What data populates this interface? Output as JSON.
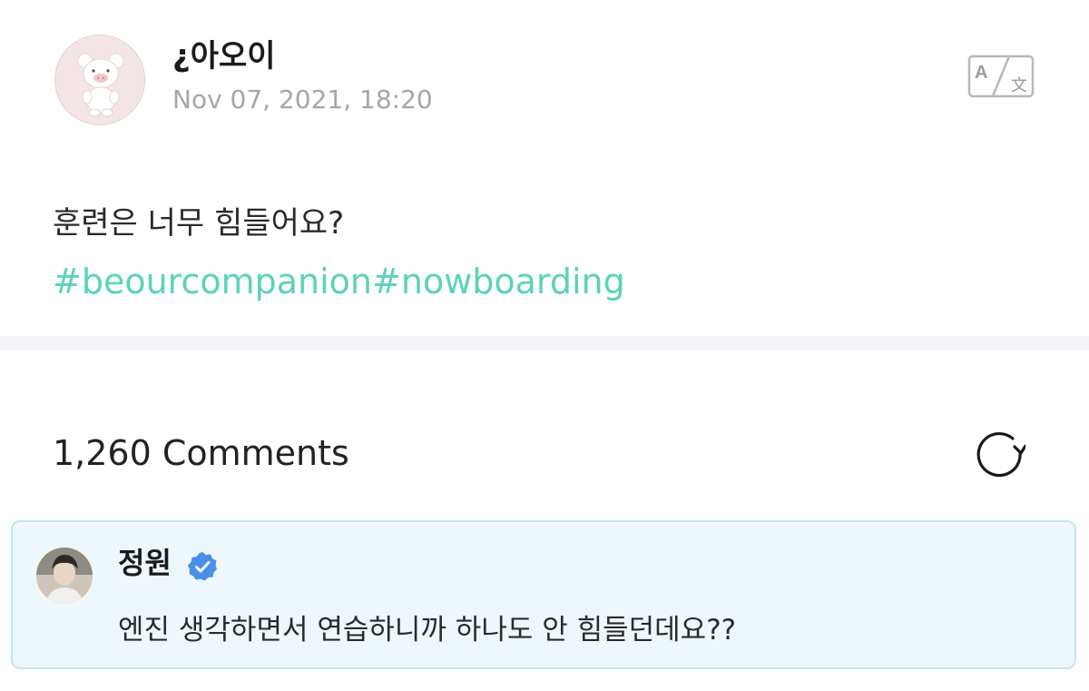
{
  "post": {
    "author_name": "¿아오이",
    "date": "Nov 07, 2021, 18:20",
    "text": "훈련은 너무 힘들어요?",
    "hashtags": [
      "#beourcompanion",
      "#nowboarding"
    ],
    "avatar_icon": "bear-mascot-avatar",
    "translate_icon": "translate-icon"
  },
  "comments": {
    "count_label": "1,260 Comments",
    "refresh_icon": "refresh-icon",
    "items": [
      {
        "author": "정원",
        "verified": true,
        "text": "엔진 생각하면서 연습하니까 하나도 안 힘들던데요??"
      }
    ]
  },
  "colors": {
    "hashtag": "#5ad3b9",
    "date": "#a6a6a6",
    "comment_bg": "#eef8fc",
    "comment_border": "#c4e6f0",
    "verified_badge": "#4a8fe8",
    "divider": "#f3f4f7"
  }
}
